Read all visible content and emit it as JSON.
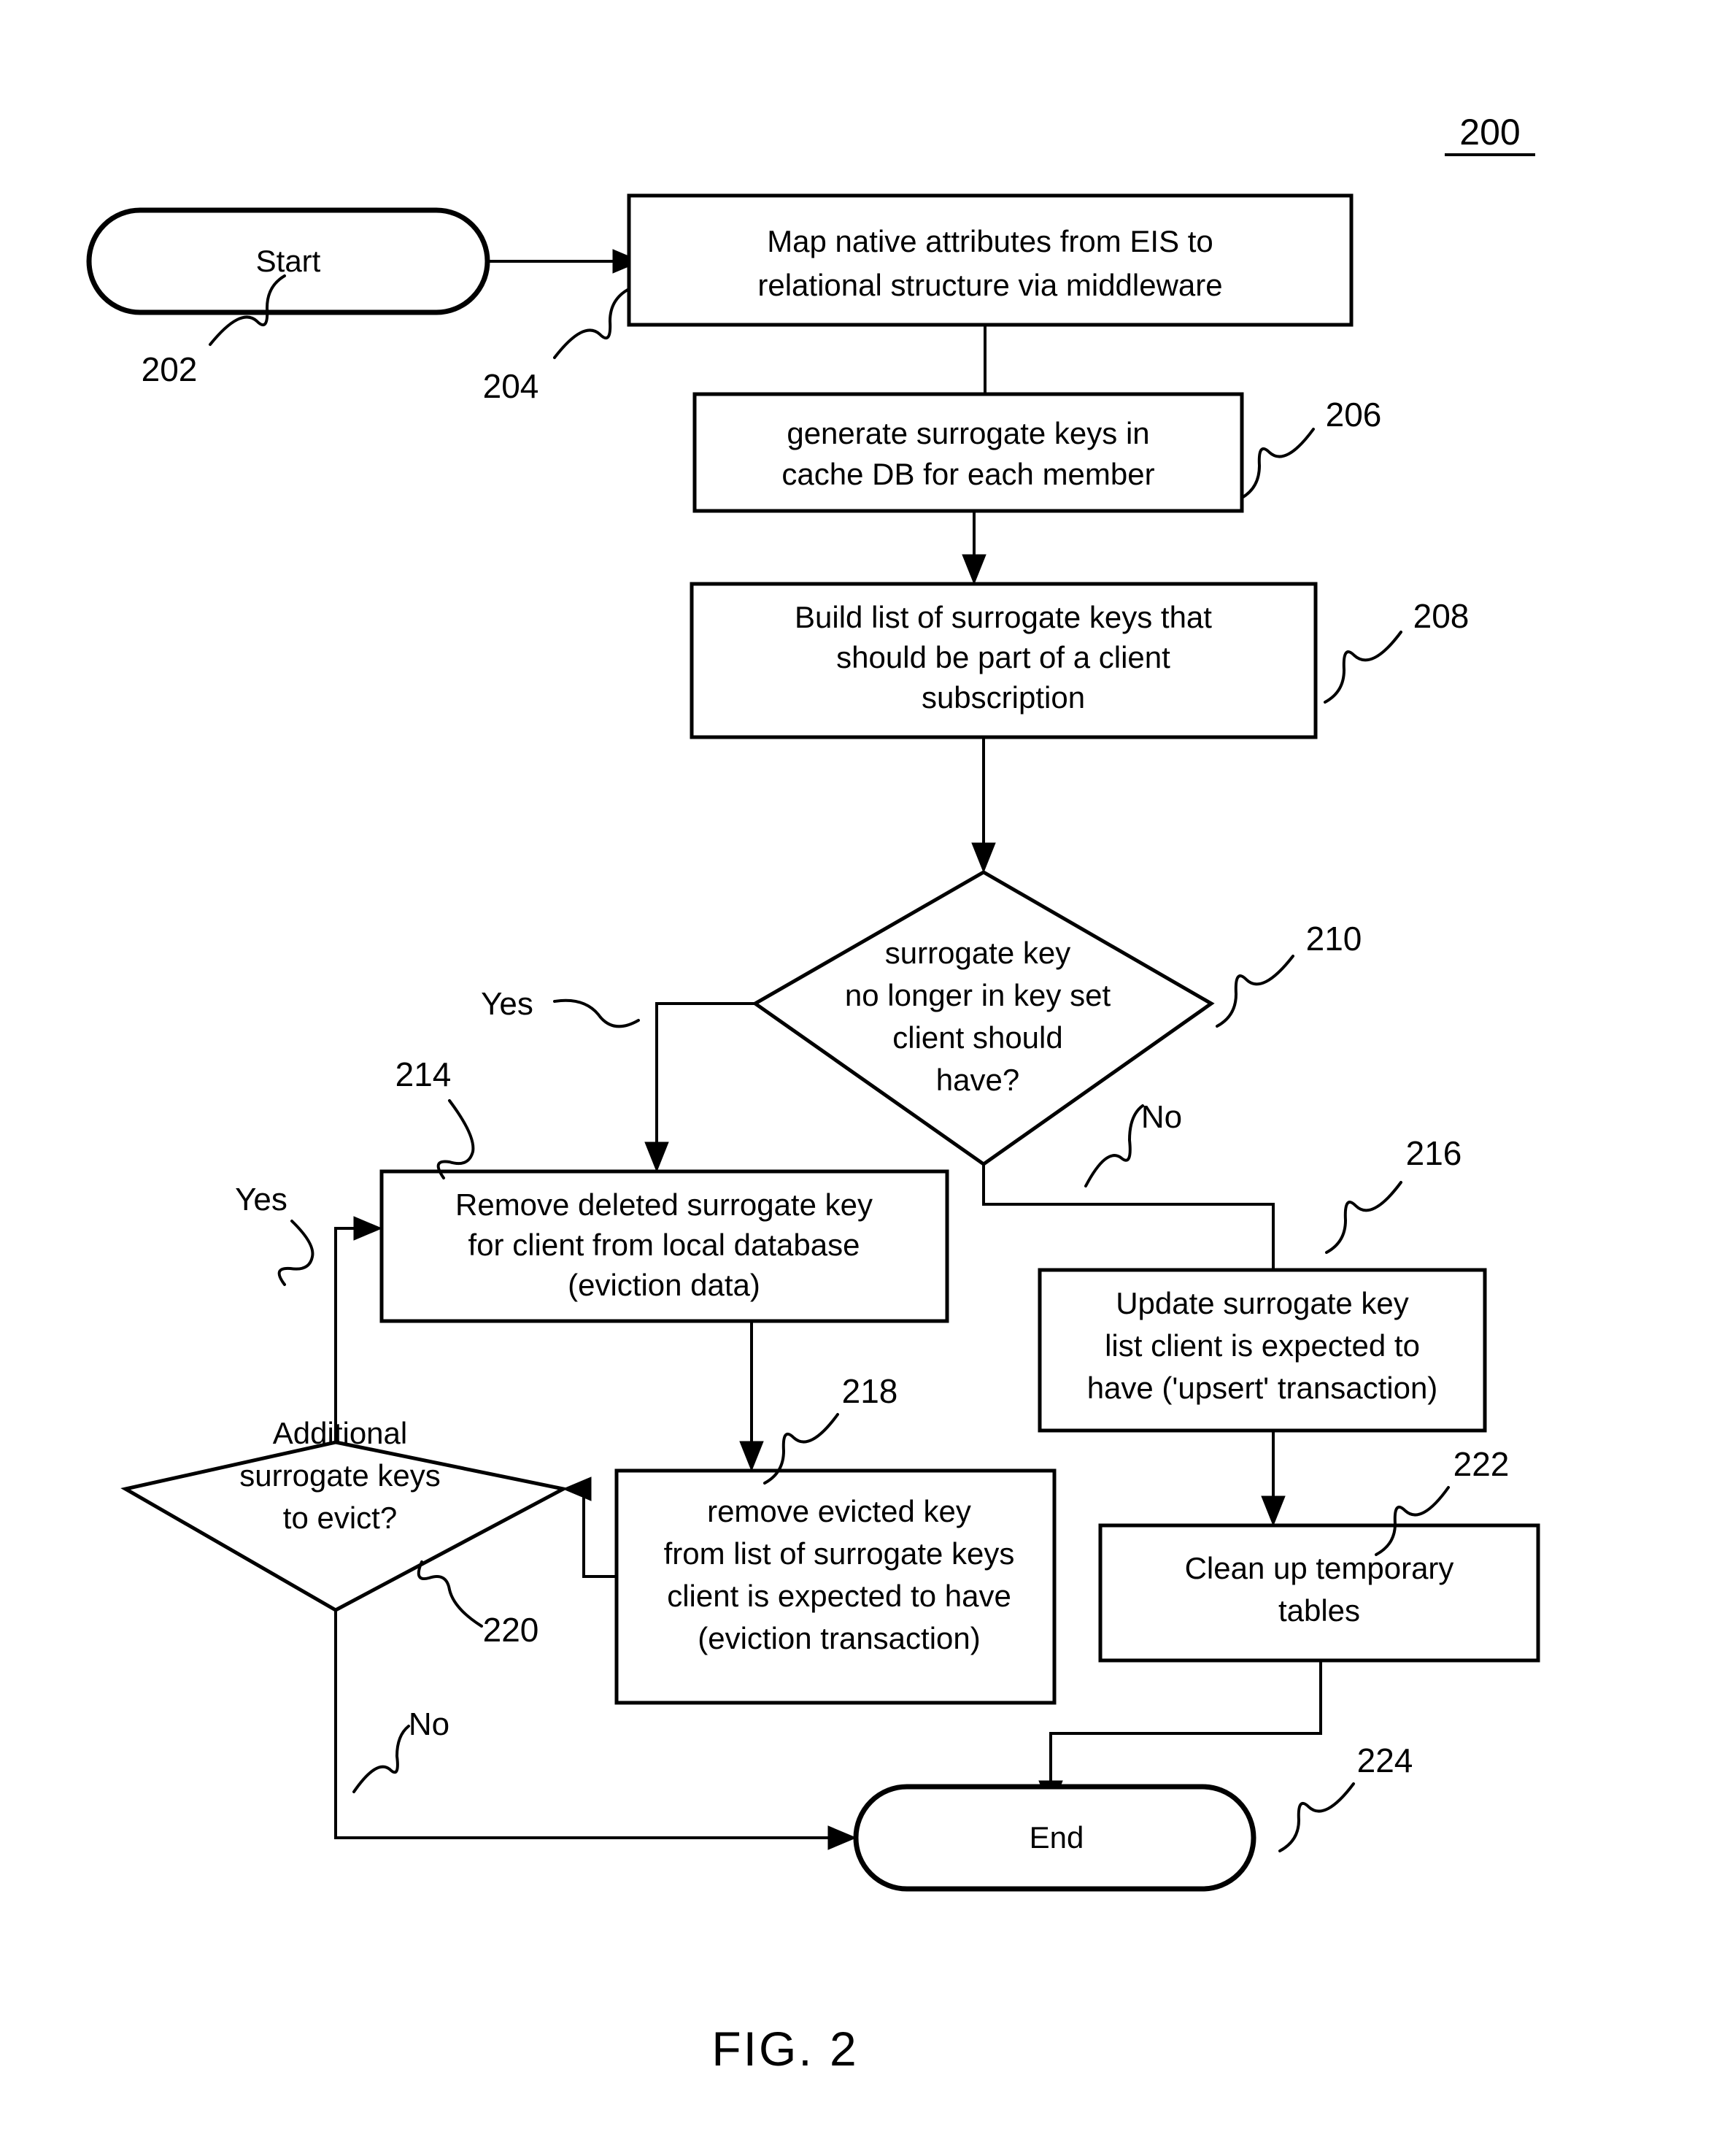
{
  "figure": {
    "id_label": "200",
    "caption": "FIG. 2"
  },
  "nodes": {
    "start": {
      "text": "Start",
      "ref": "202"
    },
    "map": {
      "line1": "Map native attributes from EIS to",
      "line2": "relational structure via middleware",
      "ref": "204"
    },
    "generate": {
      "line1": "generate surrogate keys in",
      "line2": "cache DB for each member",
      "ref": "206"
    },
    "build": {
      "line1": "Build list of surrogate keys that",
      "line2": "should be part of a client",
      "line3": "subscription",
      "ref": "208"
    },
    "decision_key": {
      "line1": "surrogate key",
      "line2": "no longer in key set",
      "line3": "client should",
      "line4": "have?",
      "ref": "210"
    },
    "remove_deleted": {
      "line1": "Remove deleted surrogate key",
      "line2": "for client from local database",
      "line3": "(eviction data)",
      "ref": "214"
    },
    "update_list": {
      "line1": "Update surrogate key",
      "line2": "list client is expected to",
      "line3": "have ('upsert' transaction)",
      "ref": "216"
    },
    "remove_evicted": {
      "line1": "remove evicted key",
      "line2": "from list of surrogate keys",
      "line3": "client is expected to have",
      "line4": "(eviction transaction)",
      "ref": "218"
    },
    "decision_more": {
      "line1": "Additional",
      "line2": "surrogate keys",
      "line3": "to evict?",
      "ref": "220"
    },
    "cleanup": {
      "line1": "Clean up temporary",
      "line2": "tables",
      "ref": "222"
    },
    "end": {
      "text": "End",
      "ref": "224"
    }
  },
  "branch_labels": {
    "key_yes": "Yes",
    "key_no": "No",
    "more_yes": "Yes",
    "more_no": "No"
  }
}
